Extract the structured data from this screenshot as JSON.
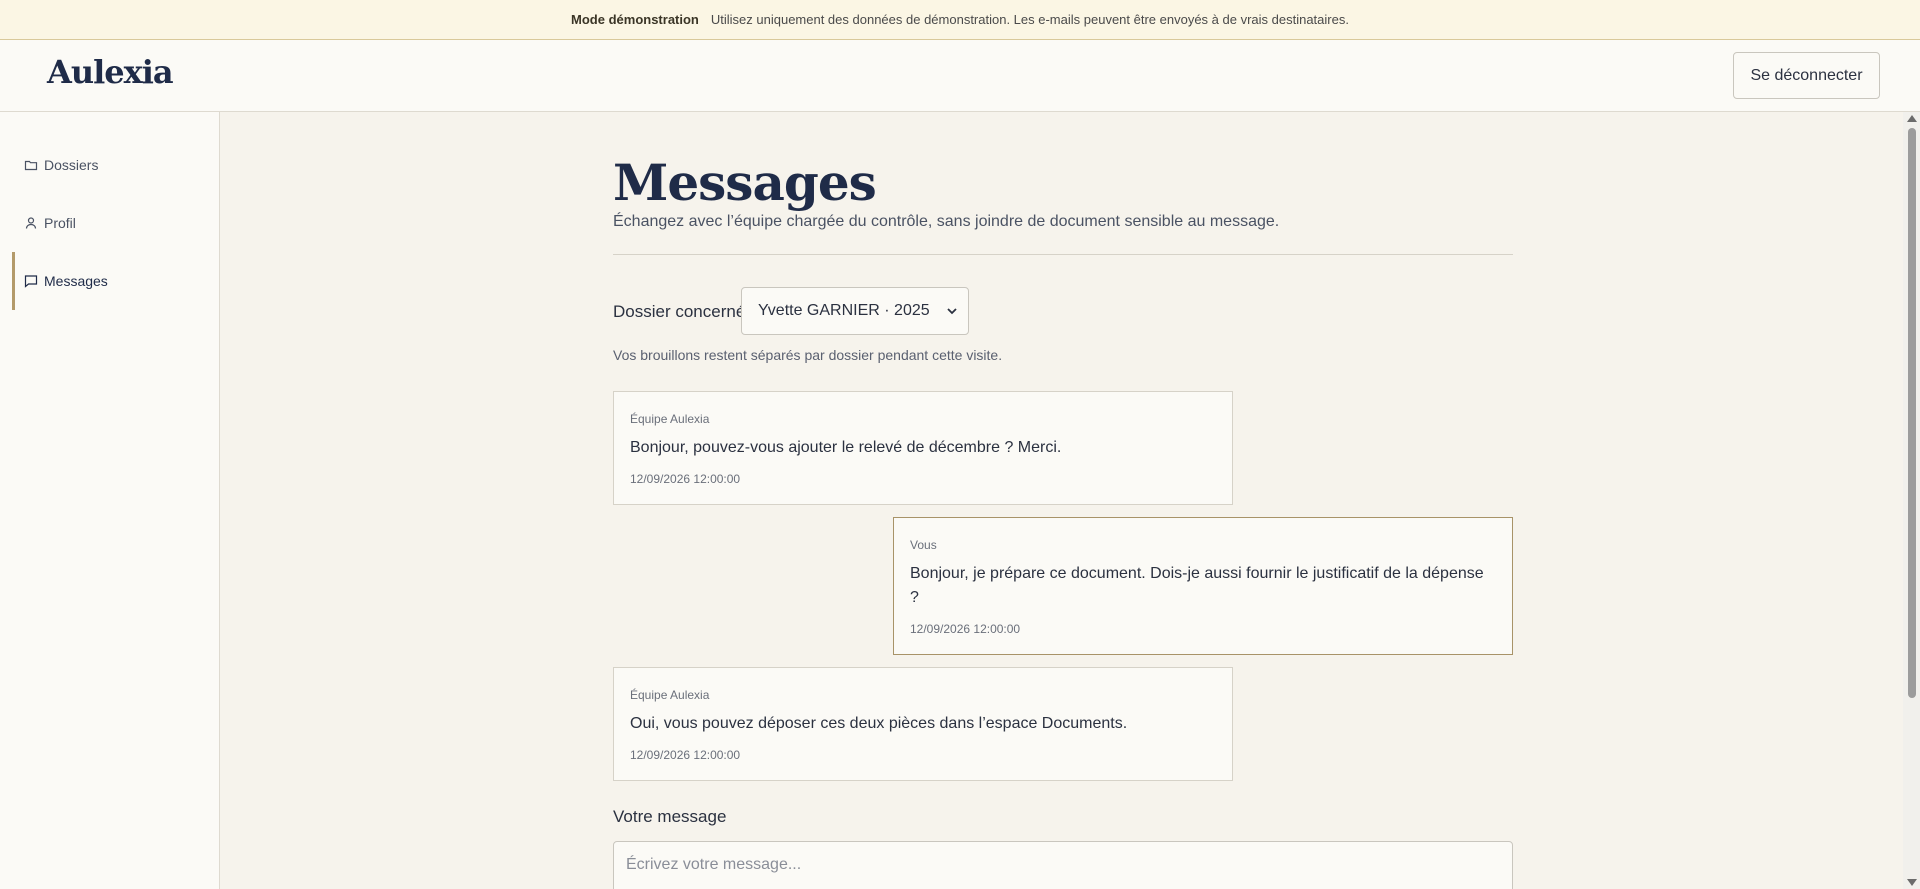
{
  "banner": {
    "title": "Mode démonstration",
    "text": "Utilisez uniquement des données de démonstration. Les e-mails peuvent être envoyés à de vrais destinataires."
  },
  "header": {
    "logo": "Aulexia",
    "logout_label": "Se déconnecter"
  },
  "sidebar": {
    "items": [
      {
        "label": "Dossiers",
        "icon": "folder-icon"
      },
      {
        "label": "Profil",
        "icon": "user-icon"
      },
      {
        "label": "Messages",
        "icon": "chat-icon",
        "active": true
      }
    ]
  },
  "main": {
    "title": "Messages",
    "subtitle": "Échangez avec l’équipe chargée du contrôle, sans joindre de document sensible au message.",
    "dossier_label": "Dossier concerné",
    "dossier_selected": "Yvette GARNIER · 2025",
    "drafts_note": "Vos brouillons restent séparés par dossier pendant cette visite.",
    "messages": [
      {
        "author": "Équipe Aulexia",
        "body": "Bonjour, pouvez-vous ajouter le relevé de décembre ? Merci.",
        "time": "12/09/2026 12:00:00",
        "mine": false
      },
      {
        "author": "Vous",
        "body": "Bonjour, je prépare ce document. Dois-je aussi fournir le justificatif de la dépense ?",
        "time": "12/09/2026 12:00:00",
        "mine": true
      },
      {
        "author": "Équipe Aulexia",
        "body": "Oui, vous pouvez déposer ces deux pièces dans l’espace Documents.",
        "time": "12/09/2026 12:00:00",
        "mine": false
      }
    ],
    "compose_label": "Votre message",
    "compose_placeholder": "Écrivez votre message..."
  },
  "colors": {
    "accent": "#b39a6a",
    "brand": "#1f2b48",
    "banner_bg": "#fbf6e4"
  }
}
